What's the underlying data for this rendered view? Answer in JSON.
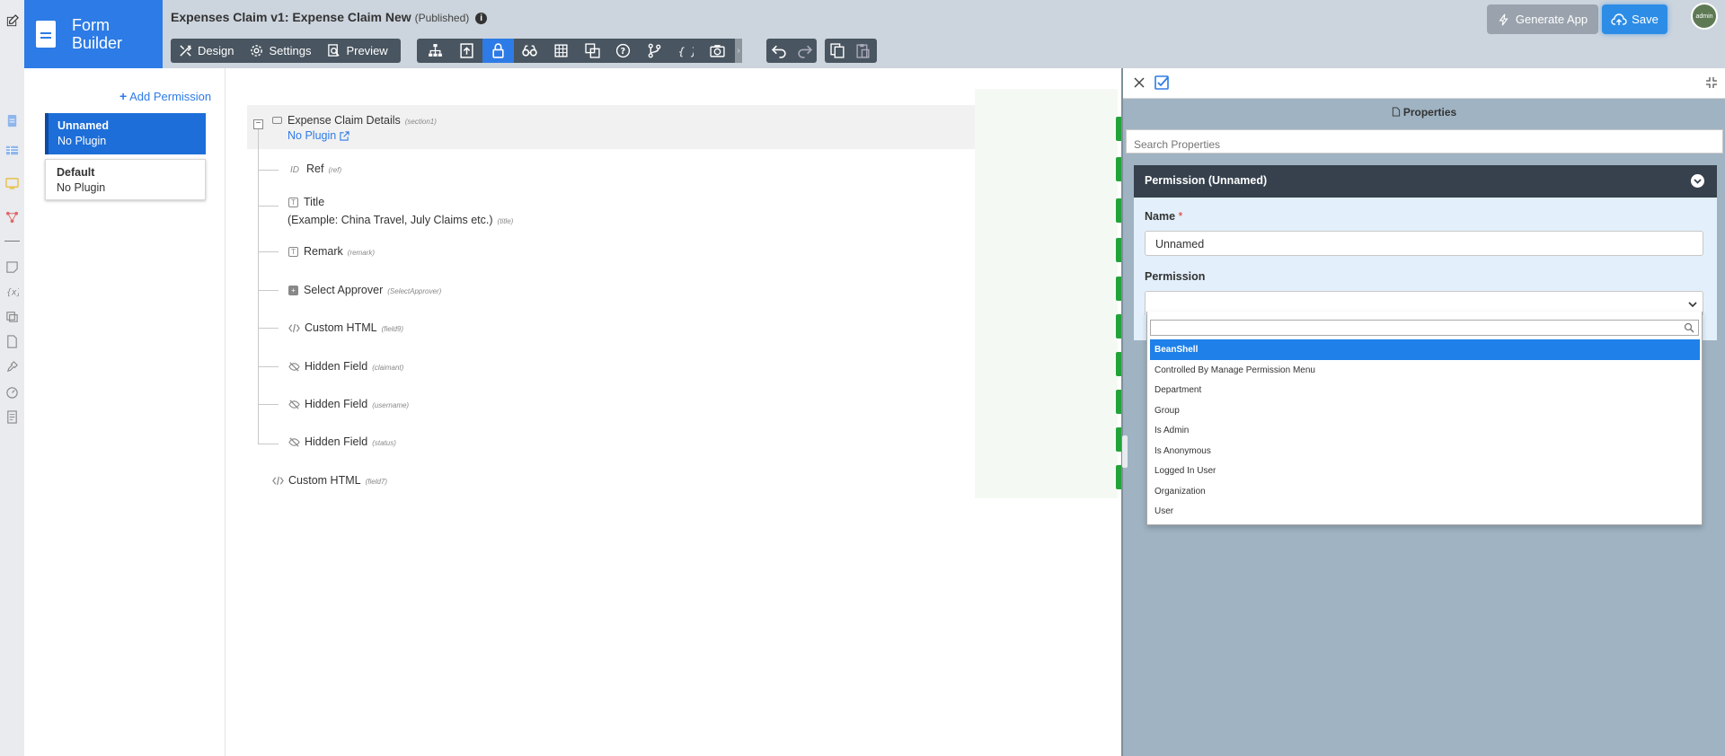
{
  "header": {
    "logo_text": "Form\nBuilder",
    "app_title": "Expenses Claim v1: Expense Claim New",
    "status": "(Published)",
    "modes": [
      {
        "label": "Design",
        "icon": "design-tools-icon"
      },
      {
        "label": "Settings",
        "icon": "gear-icon"
      },
      {
        "label": "Preview",
        "icon": "preview-search-icon"
      }
    ],
    "tools": [
      "tree-structure-icon",
      "upload-form-icon",
      "lock-icon",
      "binoculars-icon",
      "table-icon",
      "copy-images-icon",
      "help-icon",
      "branch-icon",
      "json-braces-icon",
      "camera-icon"
    ],
    "generate_app_label": "Generate App",
    "save_label": "Save",
    "avatar_text": "admin"
  },
  "permissions": {
    "add_label": "Add Permission",
    "items": [
      {
        "name": "Unnamed",
        "plugin": "No Plugin",
        "selected": true
      },
      {
        "name": "Default",
        "plugin": "No Plugin",
        "selected": false
      }
    ]
  },
  "canvas": {
    "section": {
      "label": "Expense Claim Details",
      "id": "(section1)",
      "plugin_link": "No Plugin"
    },
    "fields": [
      {
        "icon": "ID",
        "label": "Ref",
        "id": "(ref)"
      },
      {
        "icon": "T",
        "label": "Title",
        "id": ""
      },
      {
        "icon": "T",
        "label": "Remark",
        "id": "(remark)"
      },
      {
        "icon": "+",
        "label": "Select Approver",
        "id": "(SelectApprover)"
      },
      {
        "icon": "code",
        "label": "Custom HTML",
        "id": "(field9)"
      },
      {
        "icon": "eye-slash",
        "label": "Hidden Field",
        "id": "(claimant)"
      },
      {
        "icon": "eye-slash",
        "label": "Hidden Field",
        "id": "(username)"
      },
      {
        "icon": "eye-slash",
        "label": "Hidden Field",
        "id": "(status)"
      }
    ],
    "title_example": "(Example: China Travel, July Claims etc.)",
    "title_id": "(title)",
    "footer_field": {
      "label": "Custom HTML",
      "id": "(field7)"
    }
  },
  "properties": {
    "title": "Properties",
    "search_placeholder": "Search Properties",
    "panel_title": "Permission (Unnamed)",
    "name_label": "Name",
    "required_mark": "*",
    "name_value": "Unnamed",
    "permission_label": "Permission",
    "permission_value": "",
    "options": [
      "BeanShell",
      "Controlled By Manage Permission Menu",
      "Department",
      "Group",
      "Is Admin",
      "Is Anonymous",
      "Logged In User",
      "Organization",
      "User"
    ],
    "highlighted_option": "BeanShell"
  },
  "colors": {
    "brand_blue": "#2d7be6",
    "toolbar_dark": "#495560",
    "panel_bg": "#9fb3c2",
    "field_green": "#22a33a"
  }
}
